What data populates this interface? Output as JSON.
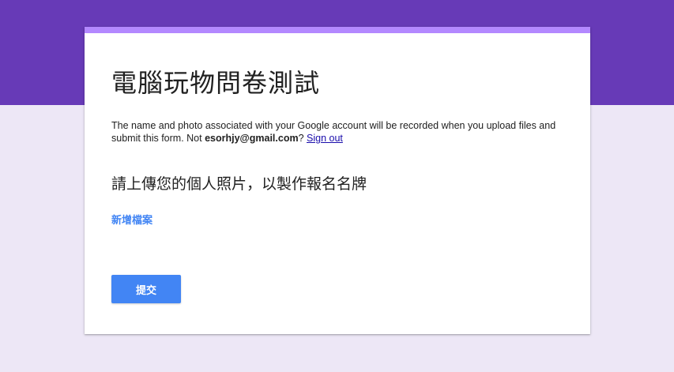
{
  "colors": {
    "header_band": "#673ab7",
    "card_top_accent": "#b388ff",
    "page_background": "#ede7f6",
    "primary_blue": "#4285f4",
    "link_blue": "#1a0dab"
  },
  "form": {
    "title": "電腦玩物問卷測試",
    "notice": {
      "text_before": "The name and photo associated with your Google account will be recorded when you upload files and submit this form. Not ",
      "email": "esorhjy@gmail.com",
      "text_after": "? ",
      "sign_out_label": "Sign out"
    },
    "question": {
      "title": "請上傳您的個人照片，以製作報名名牌",
      "add_file_label": "新增檔案"
    },
    "submit_label": "提交"
  }
}
